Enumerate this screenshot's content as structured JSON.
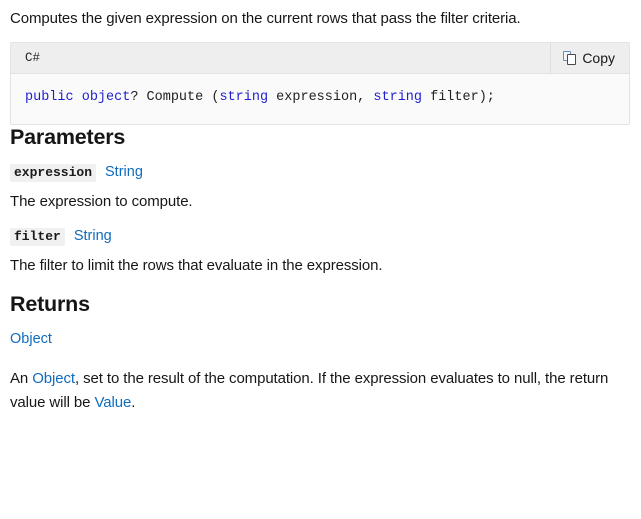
{
  "intro": {
    "text": "Computes the given expression on the current rows that pass the filter criteria."
  },
  "code_block": {
    "language_label": "C#",
    "copy_label": "Copy",
    "copy_icon": "copy-icon",
    "signature": {
      "full": "public object? Compute (string expression, string filter);",
      "tokens": {
        "kw_public": "public",
        "kw_object": "object",
        "after_object": "? Compute (",
        "kw_string_1": "string",
        "param_1": " expression, ",
        "kw_string_2": "string",
        "param_2": " filter);"
      }
    }
  },
  "parameters": {
    "heading": "Parameters",
    "items": [
      {
        "name": "expression",
        "type": "String",
        "description": "The expression to compute."
      },
      {
        "name": "filter",
        "type": "String",
        "description": "The filter to limit the rows that evaluate in the expression."
      }
    ]
  },
  "returns": {
    "heading": "Returns",
    "type": "Object",
    "description": {
      "prefix": "An ",
      "link_object": "Object",
      "middle": ", set to the result of the computation. If the expression evaluates to null, the return value will be ",
      "link_value": "Value",
      "suffix": "."
    }
  },
  "colors": {
    "link": "#0f6cbd",
    "keyword": "#1f1fd0",
    "text": "#171717",
    "code_header_bg": "#eeeeee",
    "code_body_bg": "#fafafa",
    "code_border": "#e3e3e3",
    "param_chip_bg": "#f0f0f0"
  }
}
